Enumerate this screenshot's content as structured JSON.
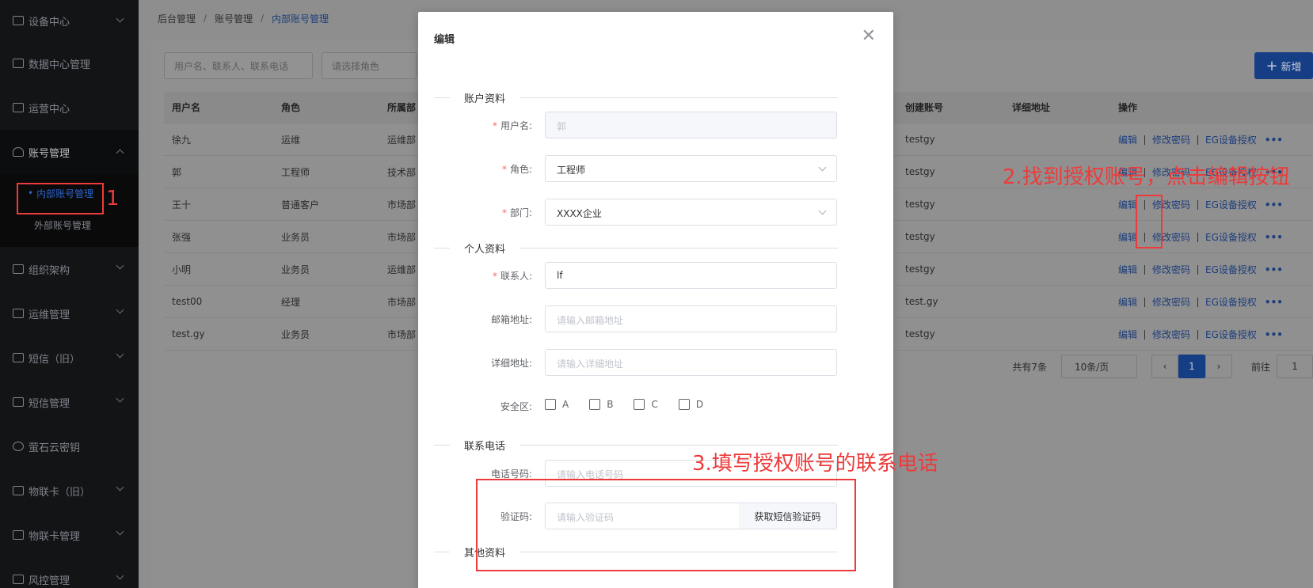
{
  "sidebar": {
    "items": [
      {
        "label": "设备中心",
        "icon": "device-icon"
      },
      {
        "label": "数据中心管理",
        "icon": "chart-icon"
      },
      {
        "label": "运营中心",
        "icon": "monitor-icon"
      },
      {
        "label": "账号管理",
        "icon": "user-icon"
      },
      {
        "label": "组织架构",
        "icon": "org-icon"
      },
      {
        "label": "运维管理",
        "icon": "ops-icon"
      },
      {
        "label": "短信（旧）",
        "icon": "mail-icon"
      },
      {
        "label": "短信管理",
        "icon": "mail-icon"
      },
      {
        "label": "萤石云密钥",
        "icon": "key-icon"
      },
      {
        "label": "物联卡（旧）",
        "icon": "card-icon"
      },
      {
        "label": "物联卡管理",
        "icon": "card-icon"
      },
      {
        "label": "风控管理",
        "icon": "risk-icon"
      }
    ],
    "submenu": [
      "内部账号管理",
      "外部账号管理"
    ]
  },
  "breadcrumb": [
    "后台管理",
    "账号管理",
    "内部账号管理"
  ],
  "search": {
    "user_placeholder": "用户名、联系人、联系电话",
    "role_placeholder": "请选择角色"
  },
  "add_button": "新增",
  "table": {
    "headers": [
      "用户名",
      "角色",
      "所属部",
      "创建账号",
      "详细地址",
      "操作"
    ],
    "rows": [
      {
        "user": "徐九",
        "role": "运维",
        "dept": "运维部",
        "creator": "testgy"
      },
      {
        "user": "郭",
        "role": "工程师",
        "dept": "技术部",
        "creator": "testgy"
      },
      {
        "user": "王十",
        "role": "普通客户",
        "dept": "市场部",
        "creator": "testgy"
      },
      {
        "user": "张强",
        "role": "业务员",
        "dept": "市场部",
        "creator": "testgy"
      },
      {
        "user": "小明",
        "role": "业务员",
        "dept": "运维部",
        "creator": "testgy"
      },
      {
        "user": "test00",
        "role": "经理",
        "dept": "市场部",
        "creator": "test.gy"
      },
      {
        "user": "test.gy",
        "role": "业务员",
        "dept": "市场部",
        "creator": "testgy"
      }
    ],
    "ops": {
      "edit": "编辑",
      "change_pwd": "修改密码",
      "eg_auth": "EG设备授权",
      "more": "•••"
    }
  },
  "pager": {
    "total": "共有7条",
    "page_size": "10条/页",
    "current": "1",
    "goto": "前往",
    "goto_value": "1"
  },
  "modal": {
    "title": "编辑",
    "sections": {
      "account": "账户资料",
      "personal": "个人资料",
      "contact": "联系电话",
      "other": "其他资料"
    },
    "fields": {
      "username_label": "用户名:",
      "username_value": "郭",
      "role_label": "角色:",
      "role_value": "工程师",
      "dept_label": "部门:",
      "dept_value": "XXXX企业",
      "contact_label": "联系人:",
      "contact_value": "lf",
      "email_label": "邮箱地址:",
      "email_placeholder": "请输入邮箱地址",
      "address_label": "详细地址:",
      "address_placeholder": "请输入详细地址",
      "zone_label": "安全区:",
      "zones": [
        "A",
        "B",
        "C",
        "D"
      ],
      "phone_label": "电话号码:",
      "phone_placeholder": "请输入电话号码",
      "code_label": "验证码:",
      "code_placeholder": "请输入验证码",
      "sms_button": "获取短信验证码"
    }
  },
  "annotations": {
    "step1": "1",
    "step2": "2.找到授权账号，点击编辑按钮",
    "step3": "3.填写授权账号的联系电话"
  },
  "colors": {
    "accent": "#163e85",
    "annotation": "#ee3a3a",
    "required": "#f56c6c"
  }
}
